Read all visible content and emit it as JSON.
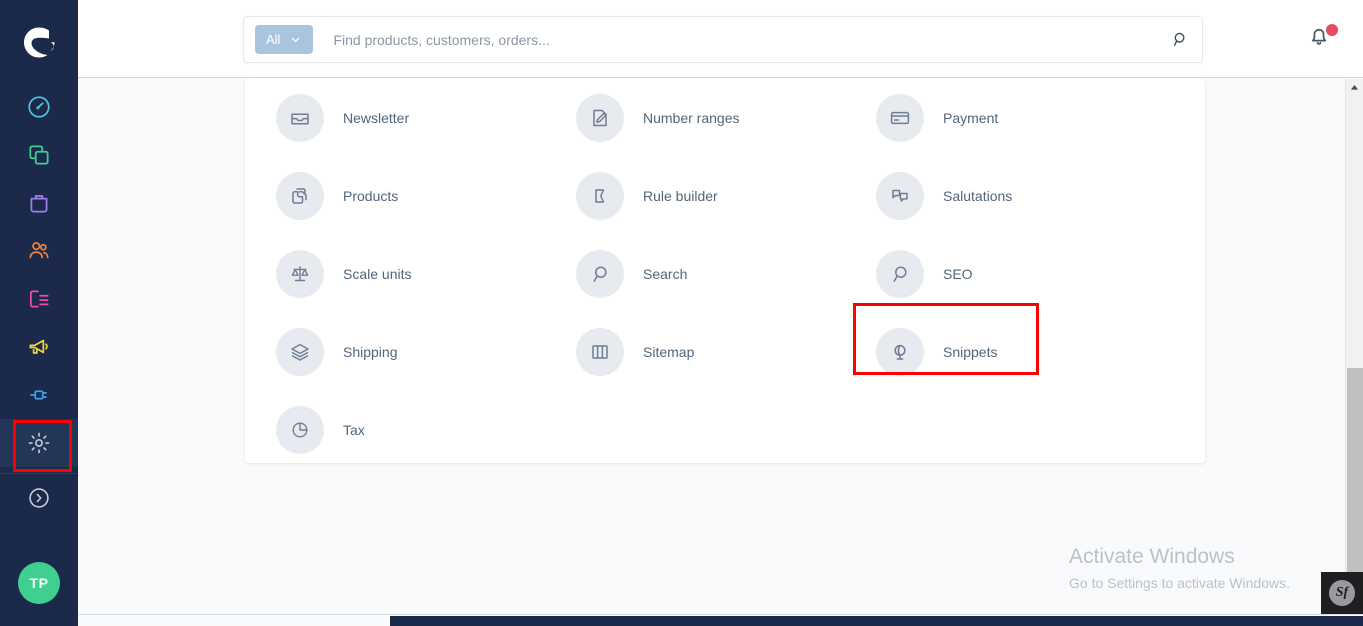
{
  "app": {
    "name": "Shopware Administration",
    "logo_icon": "shopware-logo-icon"
  },
  "sidebar": {
    "items": [
      {
        "name": "dashboard",
        "icon": "speedometer-icon",
        "color": "#4fc3e0",
        "active": false,
        "highlighted": false
      },
      {
        "name": "catalogues",
        "icon": "layers-icon",
        "color": "#3ecf8e",
        "active": false,
        "highlighted": false
      },
      {
        "name": "orders",
        "icon": "bag-icon",
        "color": "#a07cf0",
        "active": false,
        "highlighted": false
      },
      {
        "name": "customers",
        "icon": "users-icon",
        "color": "#f0803c",
        "active": false,
        "highlighted": false
      },
      {
        "name": "content",
        "icon": "content-icon",
        "color": "#f04b9e",
        "active": false,
        "highlighted": false
      },
      {
        "name": "marketing",
        "icon": "megaphone-icon",
        "color": "#f0d43c",
        "active": false,
        "highlighted": false
      },
      {
        "name": "extensions",
        "icon": "plug-icon",
        "color": "#3b9ff0",
        "active": false,
        "highlighted": false
      },
      {
        "name": "settings",
        "icon": "gear-icon",
        "color": "#c3cbd8",
        "active": true,
        "highlighted": true
      },
      {
        "name": "help",
        "icon": "chevron-circle-icon",
        "color": "#c3cbd8",
        "active": false,
        "highlighted": false
      }
    ],
    "avatar": {
      "initials": "TP",
      "color": "#3fcf8e"
    }
  },
  "header": {
    "search": {
      "scope_label": "All",
      "scope_icon": "chevron-down-icon",
      "placeholder": "Find products, customers, orders...",
      "value": "",
      "submit_icon": "search-icon"
    },
    "notifications": {
      "icon": "bell-icon",
      "has_unread": true,
      "dot_color": "#e84a5f"
    }
  },
  "main": {
    "settings_tiles": [
      {
        "label": "Newsletter",
        "icon": "inbox-icon",
        "highlighted": false
      },
      {
        "label": "Number ranges",
        "icon": "edit-document-icon",
        "highlighted": false
      },
      {
        "label": "Payment",
        "icon": "credit-card-icon",
        "highlighted": false
      },
      {
        "label": "Products",
        "icon": "copy-icon",
        "highlighted": false
      },
      {
        "label": "Rule builder",
        "icon": "rule-flag-icon",
        "highlighted": false
      },
      {
        "label": "Salutations",
        "icon": "chat-bubbles-icon",
        "highlighted": false
      },
      {
        "label": "Scale units",
        "icon": "scales-icon",
        "highlighted": false
      },
      {
        "label": "Search",
        "icon": "search-icon",
        "highlighted": false
      },
      {
        "label": "SEO",
        "icon": "search-icon",
        "highlighted": false
      },
      {
        "label": "Shipping",
        "icon": "box-icon",
        "highlighted": false
      },
      {
        "label": "Sitemap",
        "icon": "map-book-icon",
        "highlighted": false
      },
      {
        "label": "Snippets",
        "icon": "globe-lamp-icon",
        "highlighted": true
      },
      {
        "label": "Tax",
        "icon": "pie-chart-icon",
        "highlighted": false
      }
    ]
  },
  "watermark": {
    "title": "Activate Windows",
    "subtitle": "Go to Settings to activate Windows."
  },
  "debug_toolbar": {
    "label": "Sf",
    "name": "symfony-profiler-badge"
  },
  "scrollbars": {
    "vertical_icon": "scroll-up-arrow-icon"
  },
  "colors": {
    "sidebar_bg": "#1b2a4b",
    "accent_highlight": "#ff0000",
    "tile_circle": "#e7eaef",
    "tile_icon": "#6f7e95",
    "page_bg": "#f9fafb"
  }
}
